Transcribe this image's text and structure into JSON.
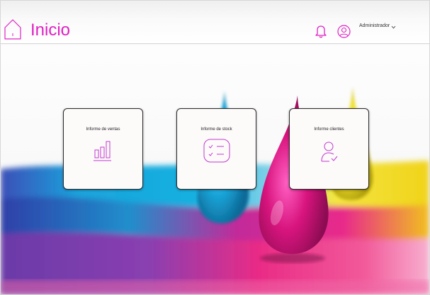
{
  "header": {
    "title": "Inicio",
    "user_name": "Administrador"
  },
  "cards": [
    {
      "label": "Informe de ventas",
      "icon": "bar-chart-icon"
    },
    {
      "label": "Informe de stock",
      "icon": "checklist-icon"
    },
    {
      "label": "Informe clientes",
      "icon": "user-check-icon"
    }
  ],
  "colors": {
    "accent": "#e020c4",
    "card_background": "#fdfafa",
    "magenta": "#d81b7a",
    "cyan": "#14a4d6",
    "yellow": "#f2e32a"
  }
}
